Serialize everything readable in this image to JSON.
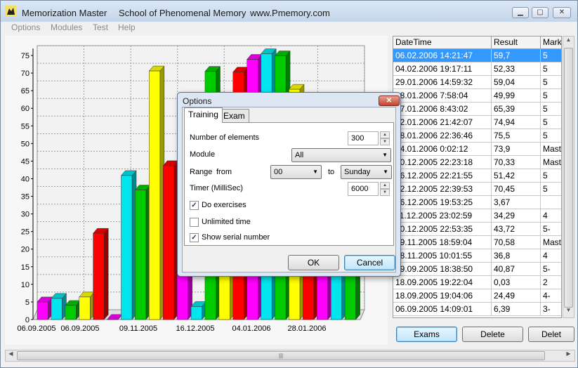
{
  "window": {
    "app_title": "Memorization Master",
    "school": "School of Phenomenal Memory",
    "website": "www.Pmemory.com",
    "minimize": "▁",
    "maximize": "▢",
    "close": "✕"
  },
  "menu": [
    "Options",
    "Modules",
    "Test",
    "Help"
  ],
  "chart_data": {
    "type": "bar",
    "ylim": [
      0,
      75
    ],
    "yticks": [
      0,
      5,
      10,
      15,
      20,
      25,
      30,
      35,
      40,
      45,
      50,
      55,
      60,
      65,
      70,
      75
    ],
    "xtick_labels": [
      "06.09.2005",
      "06.09.2005",
      "09.11.2005",
      "16.12.2005",
      "04.01.2006",
      "28.01.2006"
    ],
    "values": [
      5,
      6,
      4,
      6.4,
      24.5,
      0.03,
      40.9,
      36.8,
      70.6,
      43.7,
      34.3,
      3.7,
      70.5,
      51.4,
      70.3,
      73.9,
      75.5,
      74.9,
      65.4,
      50,
      59,
      52.3,
      59.7
    ],
    "colors": [
      "#ff00ff",
      "#00e5ee",
      "#00cc00",
      "#ffff00",
      "#ff0000"
    ],
    "grid": true
  },
  "grid": {
    "headers": [
      "DateTime",
      "Result",
      "Mark"
    ],
    "rows": [
      [
        "06.02.2006 14:21:47",
        "59,7",
        "5"
      ],
      [
        "04.02.2006 19:17:11",
        "52,33",
        "5"
      ],
      [
        "29.01.2006 14:59:32",
        "59,04",
        "5"
      ],
      [
        "28.01.2006 7:58:04",
        "49,99",
        "5"
      ],
      [
        "27.01.2006 8:43:02",
        "65,39",
        "5"
      ],
      [
        "22.01.2006 21:42:07",
        "74,94",
        "5"
      ],
      [
        "18.01.2006 22:36:46",
        "75,5",
        "5"
      ],
      [
        "04.01.2006 0:02:12",
        "73,9",
        "Maste"
      ],
      [
        "30.12.2005 22:23:18",
        "70,33",
        "Maste"
      ],
      [
        "26.12.2005 22:21:55",
        "51,42",
        "5"
      ],
      [
        "22.12.2005 22:39:53",
        "70,45",
        "5"
      ],
      [
        "16.12.2005 19:53:25",
        "3,67",
        ""
      ],
      [
        "11.12.2005 23:02:59",
        "34,29",
        "4"
      ],
      [
        "10.12.2005 22:53:35",
        "43,72",
        "5-"
      ],
      [
        "09.11.2005 18:59:04",
        "70,58",
        "Maste"
      ],
      [
        "08.11.2005 10:01:55",
        "36,8",
        "4"
      ],
      [
        "29.09.2005 18:38:50",
        "40,87",
        "5-"
      ],
      [
        "18.09.2005 19:22:04",
        "0,03",
        "2"
      ],
      [
        "18.09.2005 19:04:06",
        "24,49",
        "4-"
      ],
      [
        "06.09.2005 14:09:01",
        "6,39",
        "3-"
      ]
    ]
  },
  "buttons": {
    "exams": "Exams",
    "delete": "Delete",
    "delete2": "Delet"
  },
  "dialog": {
    "title": "Options",
    "close": "✕",
    "tabs": [
      "Training",
      "Exam"
    ],
    "number_of_elements_label": "Number of elements",
    "number_of_elements": "300",
    "module_label": "Module",
    "module_value": "All",
    "range_label": "Range",
    "from_label": "from",
    "from_value": "00",
    "to_label": "to",
    "to_value": "Sunday",
    "timer_label": "Timer (MilliSec)",
    "timer_value": "6000",
    "do_exercises": "Do exercises",
    "do_exercises_checked": true,
    "unlimited_time": "Unlimited time",
    "unlimited_time_checked": false,
    "show_serial": "Show serial number",
    "show_serial_checked": true,
    "ok": "OK",
    "cancel": "Cancel"
  },
  "hscroll_grip": "|||"
}
